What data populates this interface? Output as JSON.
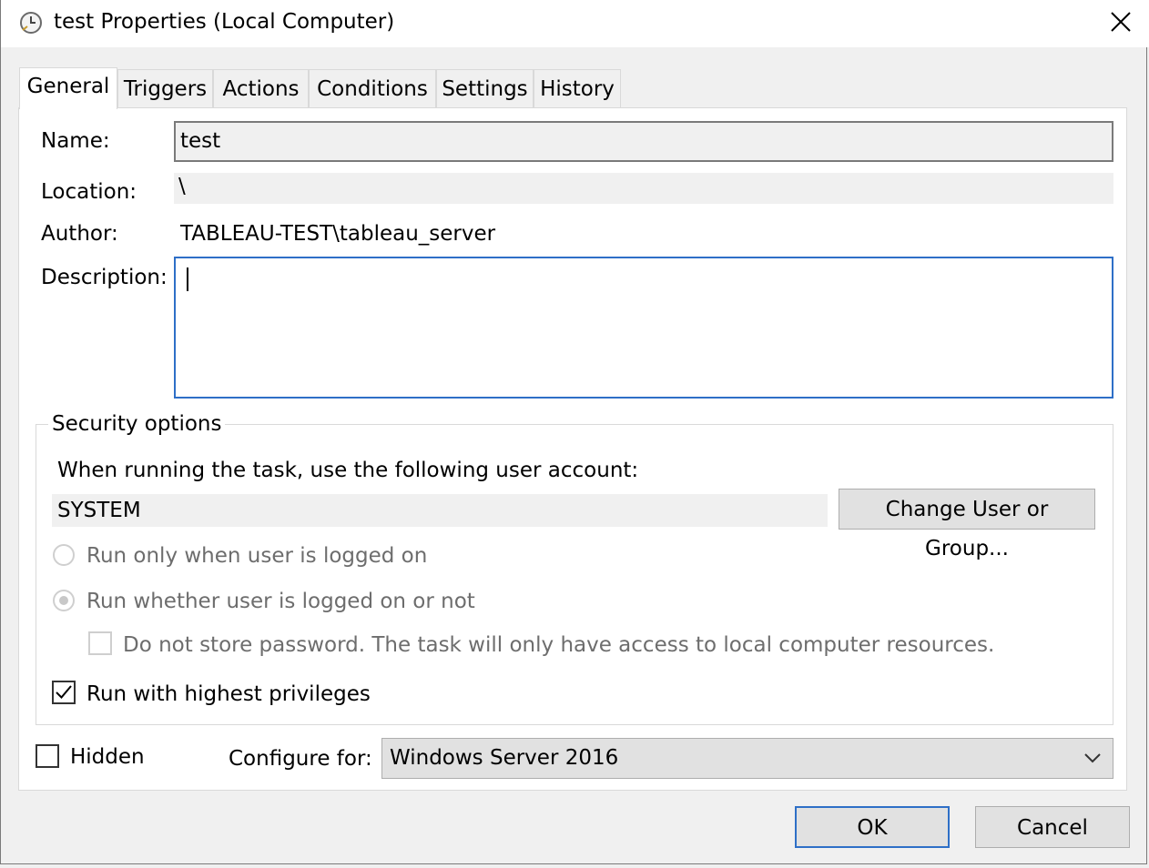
{
  "window": {
    "title": "test Properties (Local Computer)"
  },
  "tabs": [
    {
      "label": "General",
      "active": true
    },
    {
      "label": "Triggers"
    },
    {
      "label": "Actions"
    },
    {
      "label": "Conditions"
    },
    {
      "label": "Settings"
    },
    {
      "label": "History"
    }
  ],
  "general": {
    "name_label": "Name:",
    "name_value": "test",
    "location_label": "Location:",
    "location_value": "\\",
    "author_label": "Author:",
    "author_value": "TABLEAU-TEST\\tableau_server",
    "description_label": "Description:",
    "description_value": ""
  },
  "security": {
    "group_title": "Security options",
    "account_prompt": "When running the task, use the following user account:",
    "account_value": "SYSTEM",
    "change_button": "Change User or Group...",
    "radio_logged_on": "Run only when user is logged on",
    "radio_whether": "Run whether user is logged on or not",
    "do_not_store": "Do not store password.  The task will only have access to local computer resources.",
    "highest_privileges": "Run with highest privileges"
  },
  "bottom": {
    "hidden_label": "Hidden",
    "configure_label": "Configure for:",
    "configure_value": "Windows Server 2016"
  },
  "buttons": {
    "ok": "OK",
    "cancel": "Cancel"
  }
}
